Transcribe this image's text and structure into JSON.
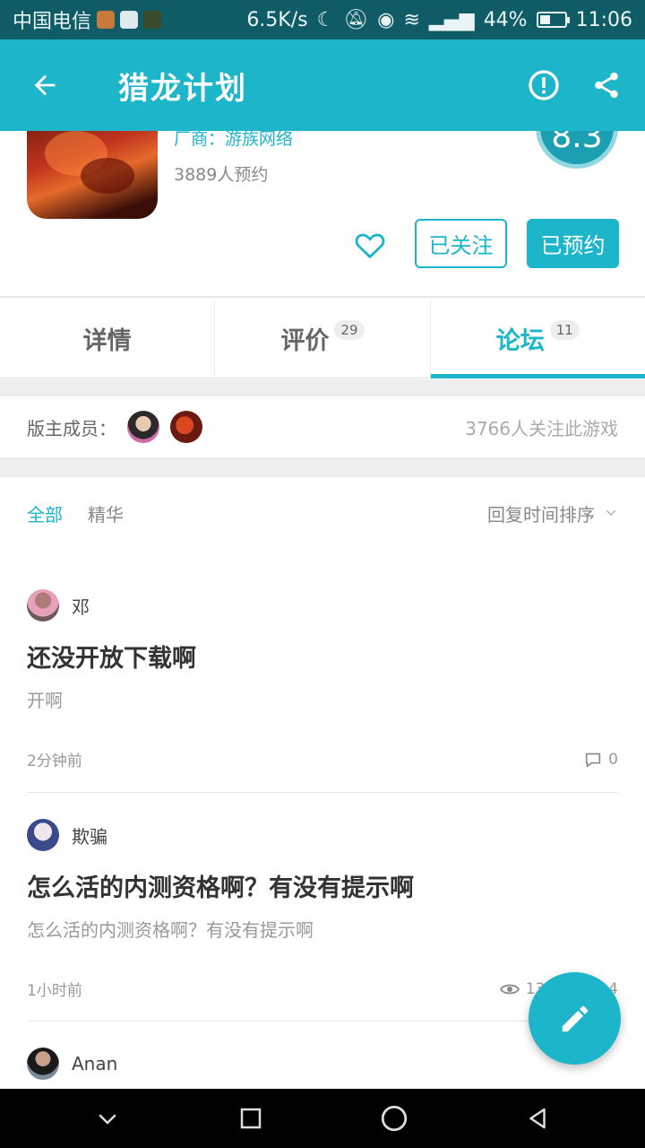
{
  "status_bar": {
    "carrier": "中国电信",
    "speed": "6.5K/s",
    "battery": "44%",
    "battery_level": 0.44,
    "time": "11:06"
  },
  "app_bar": {
    "title": "猎龙计划",
    "back_icon": "back-arrow-icon",
    "report_icon": "exclamation-circle-icon",
    "share_icon": "share-icon"
  },
  "game": {
    "vendor": "厂商：游族网络",
    "reserve_count": "3889人预约",
    "score": "8.3",
    "follow_label": "已关注",
    "reserve_label": "已预约"
  },
  "tabs": [
    {
      "label": "详情",
      "badge": ""
    },
    {
      "label": "评价",
      "badge": "29"
    },
    {
      "label": "论坛",
      "badge": "11"
    }
  ],
  "moderators": {
    "label": "版主成员：",
    "followers": "3766人关注此游戏"
  },
  "filters": {
    "all": "全部",
    "best": "精华",
    "sort": "回复时间排序"
  },
  "posts": [
    {
      "author": "邓",
      "title": "还没开放下载啊",
      "body": "开啊",
      "time": "2分钟前",
      "comments": "0"
    },
    {
      "author": "欺骗",
      "title": "怎么活的内测资格啊？有没有提示啊",
      "body": "怎么活的内测资格啊？有没有提示啊",
      "time": "1小时前",
      "views": "134",
      "comments": "4"
    },
    {
      "author": "Anan"
    }
  ],
  "colors": {
    "accent": "#1cb5c9",
    "status_bar": "#0f5c67"
  }
}
